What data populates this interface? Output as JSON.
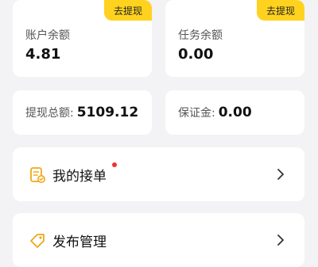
{
  "balances": [
    {
      "label": "账户余额",
      "value": "4.81",
      "action": "去提现"
    },
    {
      "label": "任务余额",
      "value": "0.00",
      "action": "去提现"
    }
  ],
  "totals": {
    "withdraw_label": "提现总额:",
    "withdraw_value": "5109.12",
    "deposit_label": "保证金:",
    "deposit_value": "0.00"
  },
  "menu": {
    "orders_label": "我的接单",
    "publish_label": "发布管理"
  },
  "colors": {
    "accent": "#ffd21f",
    "notification_dot": "#f23030",
    "icon": "#f0a818"
  }
}
